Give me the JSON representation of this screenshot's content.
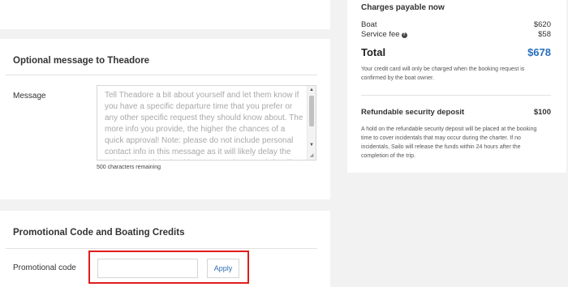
{
  "message_section": {
    "title": "Optional message to Theadore",
    "label": "Message",
    "placeholder": "Tell Theadore a bit about yourself and let them know if you have a specific departure time that you prefer or any other specific request they should know about. The more info you provide, the higher the chances of a quick approval! Note: please do not include personal contact info in this message as it will likely delay the submission of the booking. Personal contact info will automatically be",
    "remaining": "500 characters remaining"
  },
  "promo_section": {
    "title": "Promotional Code and Boating Credits",
    "label": "Promotional code",
    "input_value": "",
    "apply_label": "Apply"
  },
  "charges": {
    "title": "Charges payable now",
    "items": [
      {
        "label": "Boat",
        "value": "$620"
      },
      {
        "label": "Service fee",
        "value": "$58"
      }
    ],
    "total_label": "Total",
    "total_value": "$678",
    "total_note": "Your credit card will only be charged when the booking request is confirmed by the boat owner.",
    "deposit_label": "Refundable security deposit",
    "deposit_value": "$100",
    "deposit_note": "A hold on the refundable security deposit will be placed at the booking time to cover incidentals that may occur during the charter. If no incidentals, Sailo will release the funds within 24 hours after the completion of the trip."
  },
  "colors": {
    "accent": "#2a6fbe",
    "highlight": "#e11c1c",
    "background": "#f2f2f2"
  }
}
